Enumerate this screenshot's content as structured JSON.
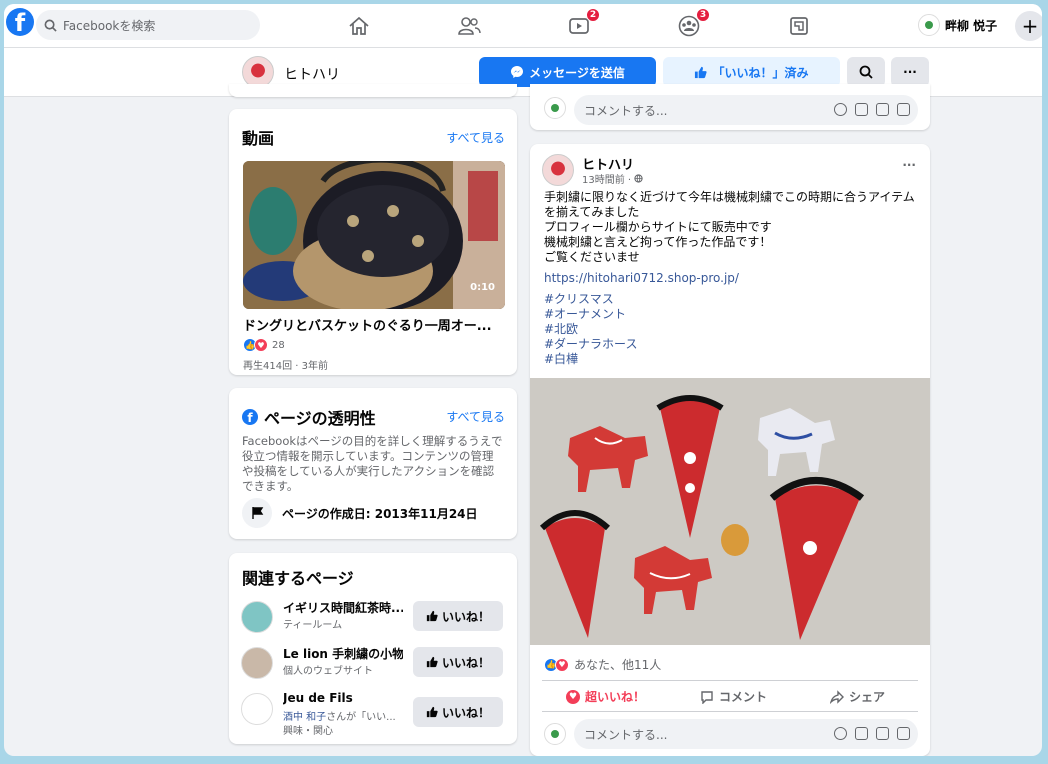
{
  "topbar": {
    "logo": "f",
    "search_placeholder": "Facebookを検索",
    "nav": [
      {
        "icon": "home-icon"
      },
      {
        "icon": "friends-icon"
      },
      {
        "icon": "watch-icon",
        "badge": "2"
      },
      {
        "icon": "groups-icon",
        "badge": "3"
      },
      {
        "icon": "gaming-icon"
      }
    ],
    "user_name": "畔柳 悦子",
    "plus": "+"
  },
  "page_header": {
    "name": "ヒトハリ",
    "message_button": "メッセージを送信",
    "liked_button": "「いいね！」済み"
  },
  "video_card": {
    "title": "動画",
    "see_all": "すべて見る",
    "duration": "0:10",
    "video_title": "ドングリとバスケットのぐるり一周オー...",
    "reaction_count": "28",
    "meta": "再生414回 · 3年前"
  },
  "transparency_card": {
    "title": "ページの透明性",
    "see_all": "すべて見る",
    "description": "Facebookはページの目的を詳しく理解するうえで役立つ情報を開示しています。コンテンツの管理や投稿をしている人が実行したアクションを確認できます。",
    "created": "ページの作成日: 2013年11月24日"
  },
  "related_card": {
    "title": "関連するページ",
    "items": [
      {
        "name": "イギリス時間紅茶時...",
        "sub": "ティールーム",
        "like": "いいね！"
      },
      {
        "name": "Le lion 手刺繍の小物",
        "sub": "個人のウェブサイト",
        "like": "いいね！"
      },
      {
        "name": "Jeu de Fils",
        "sub_highlight": "酒中 和子",
        "sub": "さんが「いい...",
        "sub2": "興味・関心",
        "like": "いいね！"
      }
    ]
  },
  "comment_placeholder": "コメントする...",
  "post": {
    "author": "ヒトハリ",
    "time": "13時間前 ·",
    "more": "···",
    "lines": [
      "手刺繍に限りなく近づけて今年は機械刺繍でこの時期に合うアイテムを揃えてみました",
      "プロフィール欄からサイトにて販売中です",
      "機械刺繍と言えど拘って作った作品です！",
      "ご覧くださいませ"
    ],
    "link": "https://hitohari0712.shop-pro.jp/",
    "tags": [
      "#クリスマス",
      "#オーナメント",
      "#北欧",
      "#ダーナラホース",
      "#白樺"
    ],
    "reactions_text": "あなた、他11人",
    "actions": {
      "love": "超いいね！",
      "comment": "コメント",
      "share": "シェア"
    }
  },
  "colors": {
    "brand_blue": "#1877f2",
    "love_red": "#f33e58",
    "frame": "#a9d6e8",
    "badge_red": "#e41e3f"
  }
}
